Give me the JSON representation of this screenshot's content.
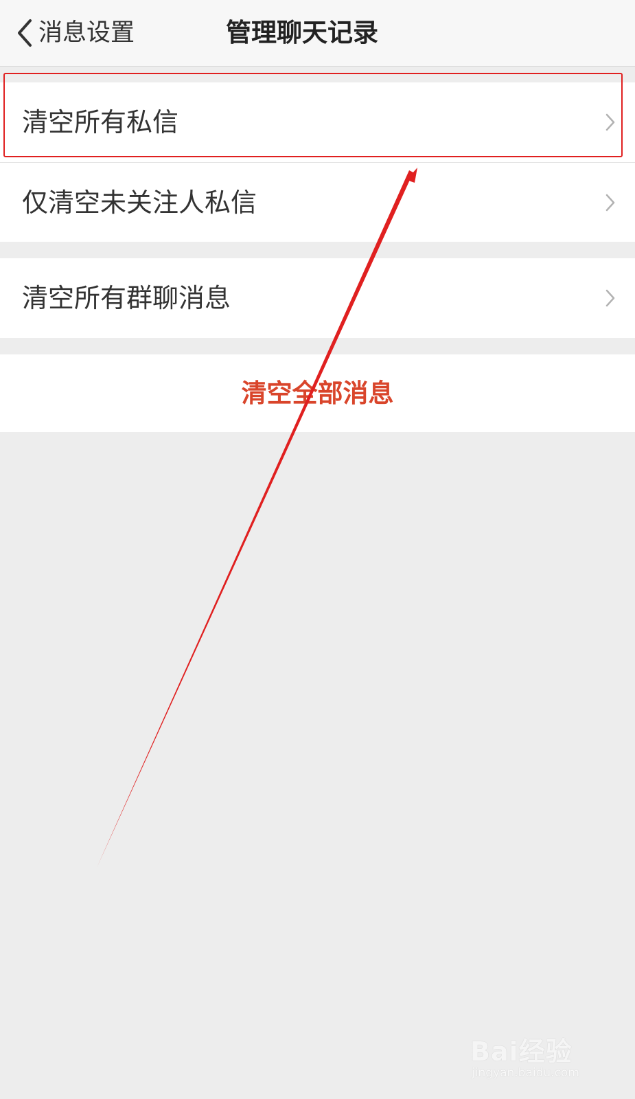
{
  "nav": {
    "back_label": "消息设置",
    "title": "管理聊天记录"
  },
  "groups": [
    {
      "items": [
        {
          "label": "清空所有私信"
        },
        {
          "label": "仅清空未关注人私信"
        }
      ]
    },
    {
      "items": [
        {
          "label": "清空所有群聊消息"
        }
      ]
    }
  ],
  "danger_action": {
    "label": "清空全部消息",
    "color": "#d9452b"
  },
  "annotation": {
    "highlight_color": "#e02020",
    "highlighted_item": "清空所有私信"
  },
  "watermark": {
    "logo": "Bai经验",
    "url": "jingyan.baidu.com"
  },
  "icons": {
    "back": "chevron-left-icon",
    "row_arrow": "chevron-right-icon"
  }
}
